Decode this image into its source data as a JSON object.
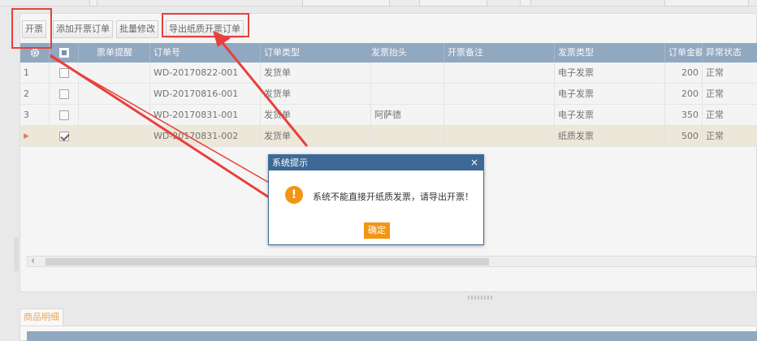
{
  "toolbar": {
    "invoice_label": "开票",
    "add_order_label": "添加开票订单",
    "batch_edit_label": "批量修改",
    "export_paper_label": "导出纸质开票订单"
  },
  "grid": {
    "columns": {
      "reminder": "票单提醒",
      "order_no": "订单号",
      "order_type": "订单类型",
      "invoice_title": "发票抬头",
      "invoice_note": "开票备注",
      "invoice_type": "发票类型",
      "amount": "订单金额",
      "status": "异常状态"
    },
    "rows": [
      {
        "num": "1",
        "checked": false,
        "order_no": "WD-20170822-001",
        "order_type": "发货单",
        "invoice_title": "",
        "invoice_type": "电子发票",
        "amount": "200",
        "status": "正常"
      },
      {
        "num": "2",
        "checked": false,
        "order_no": "WD-20170816-001",
        "order_type": "发货单",
        "invoice_title": "",
        "invoice_type": "电子发票",
        "amount": "200",
        "status": "正常"
      },
      {
        "num": "3",
        "checked": false,
        "order_no": "WD-20170831-001",
        "order_type": "发货单",
        "invoice_title": "阿萨德",
        "invoice_type": "电子发票",
        "amount": "350",
        "status": "正常"
      },
      {
        "num": "▶",
        "checked": true,
        "order_no": "WD-20170831-002",
        "order_type": "发货单",
        "invoice_title": "",
        "invoice_type": "纸质发票",
        "amount": "500",
        "status": "正常"
      }
    ]
  },
  "detail": {
    "tab_label": "商品明细"
  },
  "dialog": {
    "title": "系统提示",
    "close": "×",
    "icon": "!",
    "message": "系统不能直接开纸质发票，请导出开票！",
    "ok_label": "确定"
  },
  "colors": {
    "header": "#6f8fb2",
    "highlight": "#e8403c",
    "accent": "#f29513",
    "dialog_title": "#3c6996"
  }
}
